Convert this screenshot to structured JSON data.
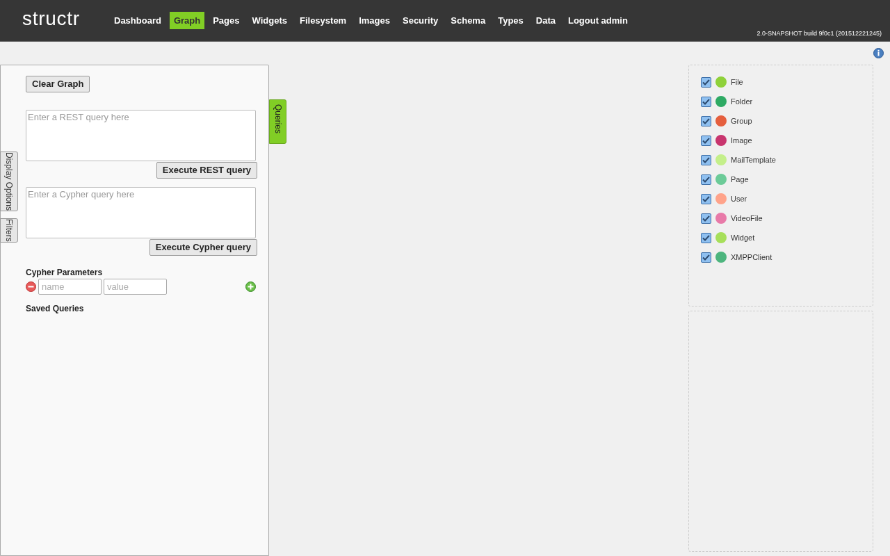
{
  "header": {
    "logo": "structr",
    "nav": [
      {
        "label": "Dashboard",
        "selected": false
      },
      {
        "label": "Graph",
        "selected": true
      },
      {
        "label": "Pages",
        "selected": false
      },
      {
        "label": "Widgets",
        "selected": false
      },
      {
        "label": "Filesystem",
        "selected": false
      },
      {
        "label": "Images",
        "selected": false
      },
      {
        "label": "Security",
        "selected": false
      },
      {
        "label": "Schema",
        "selected": false
      },
      {
        "label": "Types",
        "selected": false
      },
      {
        "label": "Data",
        "selected": false
      },
      {
        "label": "Logout admin",
        "selected": false
      }
    ],
    "version": "2.0-SNAPSHOT build 9f0c1 (201512221245)"
  },
  "side_tabs": [
    "Display Options",
    "Filters"
  ],
  "queries_panel": {
    "tab": "Queries",
    "clear_button": "Clear Graph",
    "rest": {
      "placeholder": "Enter a REST query here",
      "button": "Execute REST query"
    },
    "cypher": {
      "placeholder": "Enter a Cypher query here",
      "button": "Execute Cypher query"
    },
    "parameters": {
      "title": "Cypher Parameters",
      "name_placeholder": "name",
      "value_placeholder": "value"
    },
    "saved_title": "Saved Queries"
  },
  "types": [
    {
      "label": "File",
      "checked": true,
      "color": "#8fd13a"
    },
    {
      "label": "Folder",
      "checked": true,
      "color": "#2eaa64"
    },
    {
      "label": "Group",
      "checked": true,
      "color": "#e55f3e"
    },
    {
      "label": "Image",
      "checked": true,
      "color": "#c8356e"
    },
    {
      "label": "MailTemplate",
      "checked": true,
      "color": "#c4ef8a"
    },
    {
      "label": "Page",
      "checked": true,
      "color": "#6ccb98"
    },
    {
      "label": "User",
      "checked": true,
      "color": "#ffa38a"
    },
    {
      "label": "VideoFile",
      "checked": true,
      "color": "#e87aa8"
    },
    {
      "label": "Widget",
      "checked": true,
      "color": "#a7df5a"
    },
    {
      "label": "XMPPClient",
      "checked": true,
      "color": "#4db57e"
    }
  ]
}
